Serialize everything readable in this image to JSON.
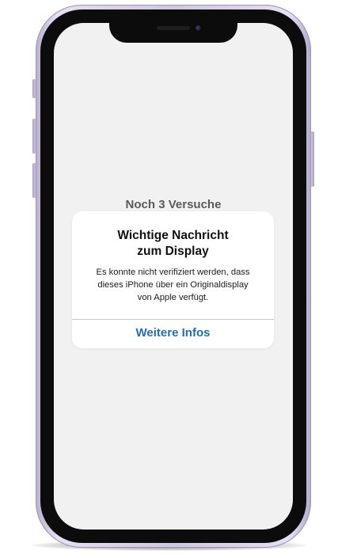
{
  "lock_screen": {
    "attempts_text": "Noch 3 Versuche"
  },
  "alert": {
    "title_line1": "Wichtige Nachricht",
    "title_line2": "zum Display",
    "message_line1": "Es konnte nicht verifiziert werden, dass",
    "message_line2": "dieses iPhone über ein Originaldisplay",
    "message_line3": "von Apple verfügt.",
    "action_label": "Weitere Infos"
  },
  "colors": {
    "action_link": "#1f6fb8",
    "screen_background": "#f1f1f2",
    "phone_frame": "#d8d0e6"
  }
}
